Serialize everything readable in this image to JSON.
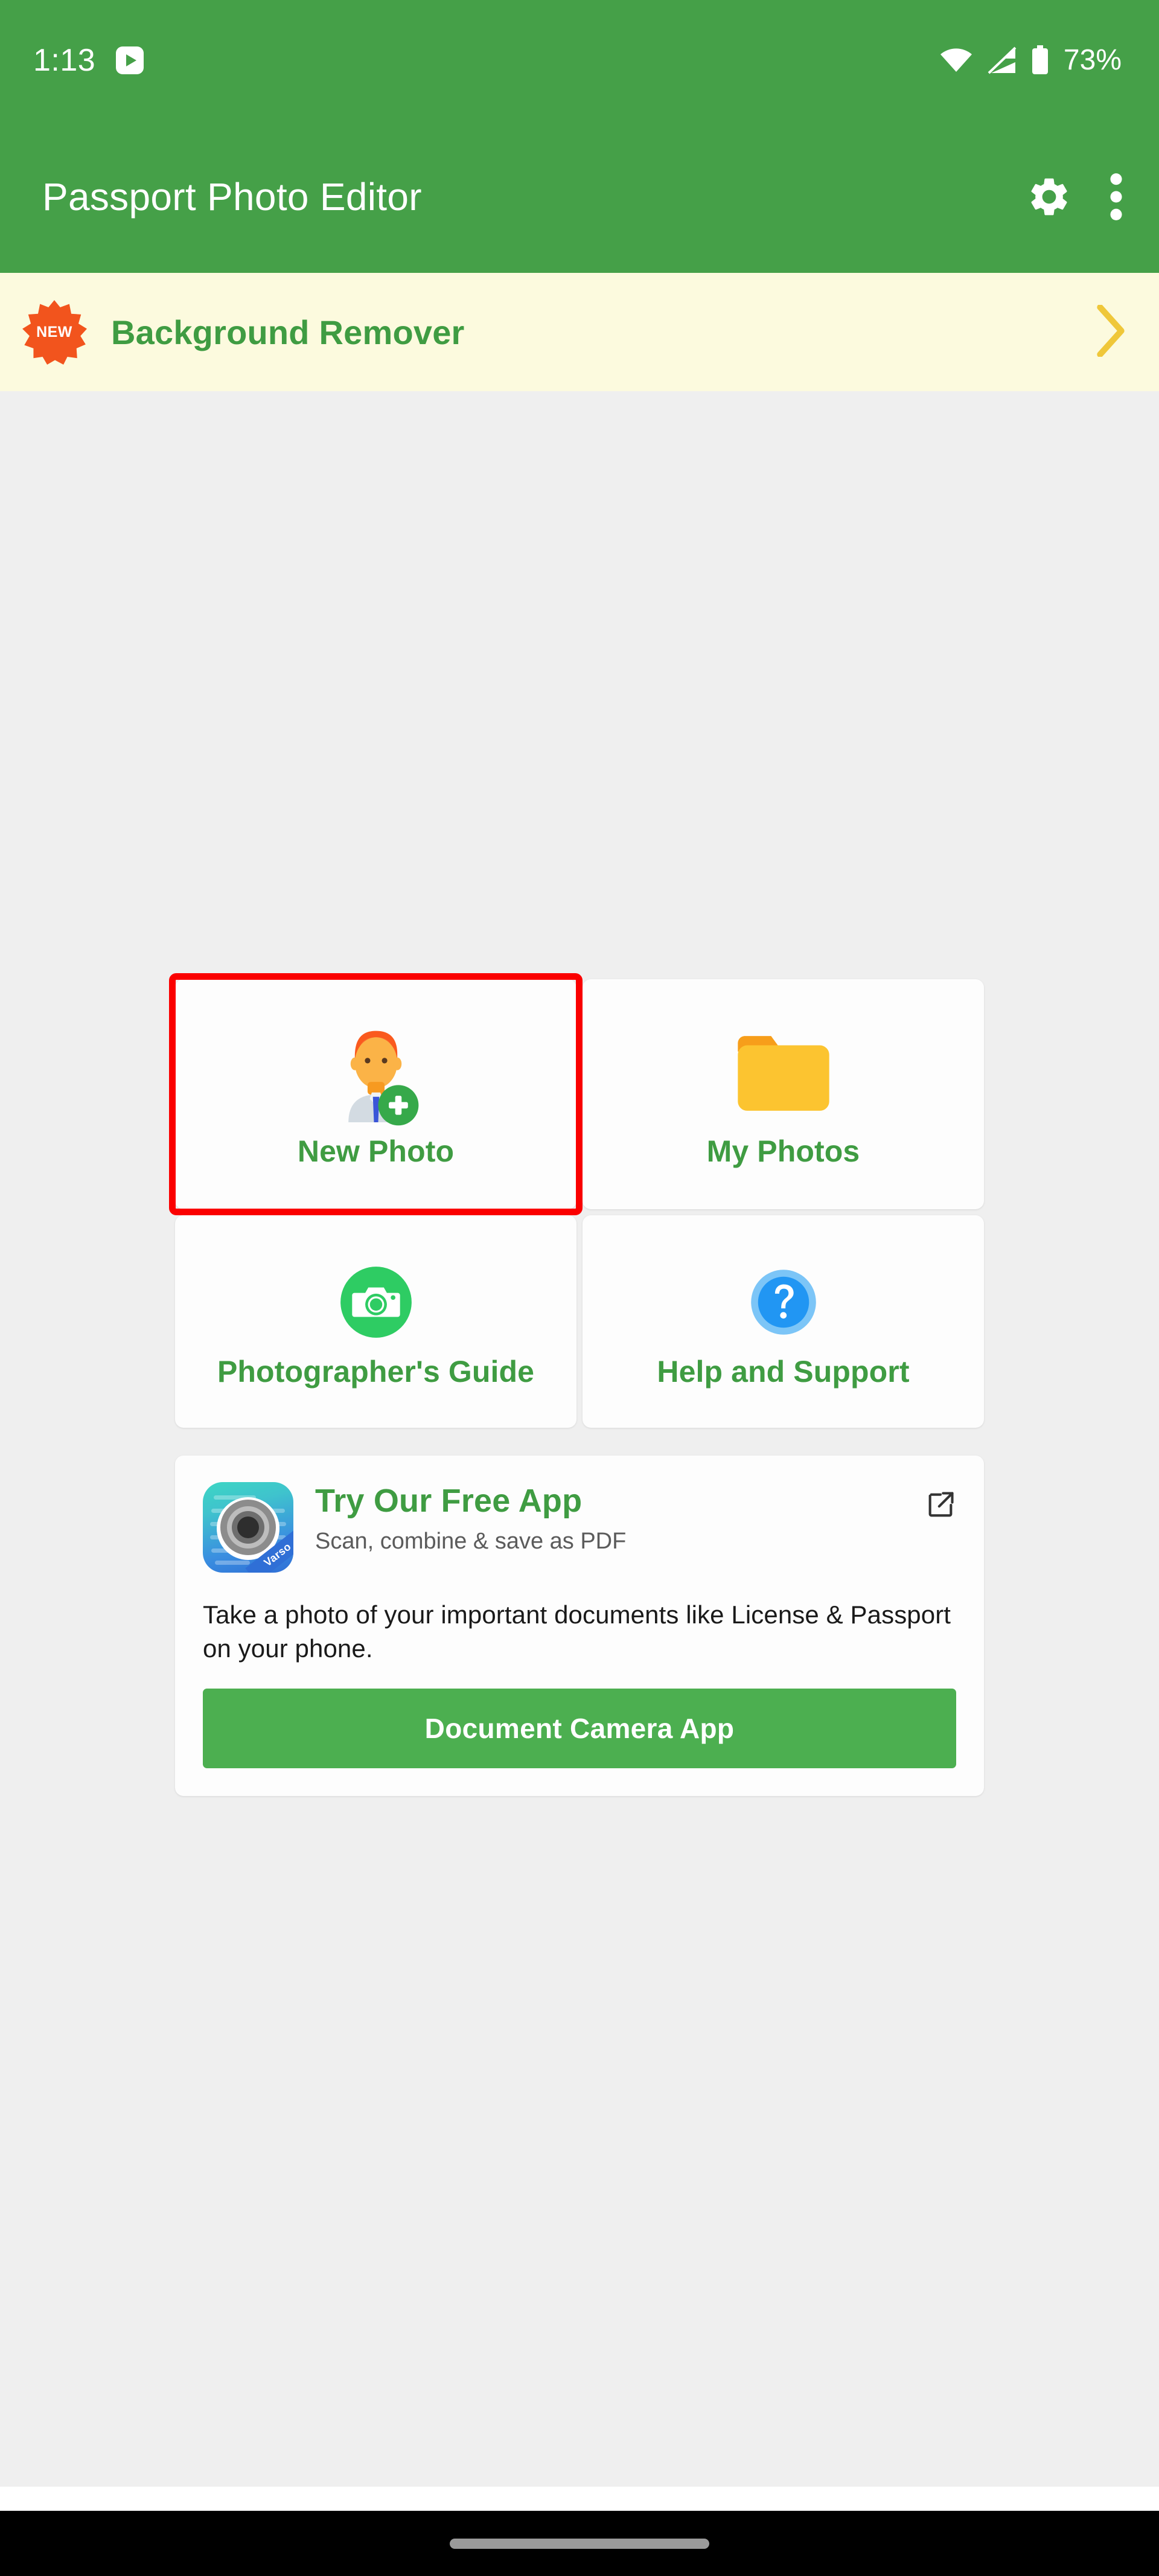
{
  "status_bar": {
    "clock": "1:13",
    "notification_icon": "youtube-icon",
    "wifi_icon": "wifi-icon",
    "signal_icon": "cellular-signal-icon",
    "battery_icon": "battery-icon",
    "battery_percent": "73%"
  },
  "app_bar": {
    "title": "Passport Photo Editor",
    "settings_icon": "gear-icon",
    "overflow_icon": "more-vertical-icon"
  },
  "banner": {
    "badge_label": "NEW",
    "title": "Background Remover",
    "chevron_icon": "chevron-right-icon"
  },
  "tiles": [
    {
      "label": "New Photo",
      "icon": "person-add-icon",
      "highlighted": true
    },
    {
      "label": "My Photos",
      "icon": "folder-icon",
      "highlighted": false
    },
    {
      "label": "Photographer's Guide",
      "icon": "camera-circle-icon",
      "highlighted": false
    },
    {
      "label": "Help and Support",
      "icon": "question-circle-icon",
      "highlighted": false
    }
  ],
  "promo": {
    "app_icon": "document-camera-app-icon",
    "app_icon_ribbon": "Varso",
    "title": "Try Our Free App",
    "subtitle": "Scan, combine & save as PDF",
    "external_link_icon": "open-in-new-icon",
    "body": "Take a photo of your important documents like License & Passport on your phone.",
    "cta_label": "Document Camera App"
  },
  "nav_bar": {
    "gesture_handle": "home-gesture-pill"
  },
  "colors": {
    "brand_green": "#45a048",
    "label_green": "#3f9c42",
    "cta_green": "#4caf50",
    "banner_bg": "#fcfade",
    "badge_orange": "#f2541d",
    "chevron_yellow": "#efc73a",
    "highlight_red": "#fb0000",
    "content_bg": "#efefef",
    "card_bg": "#fdfdfd",
    "folder_yellow": "#fcc430",
    "help_blue": "#2196f3"
  }
}
